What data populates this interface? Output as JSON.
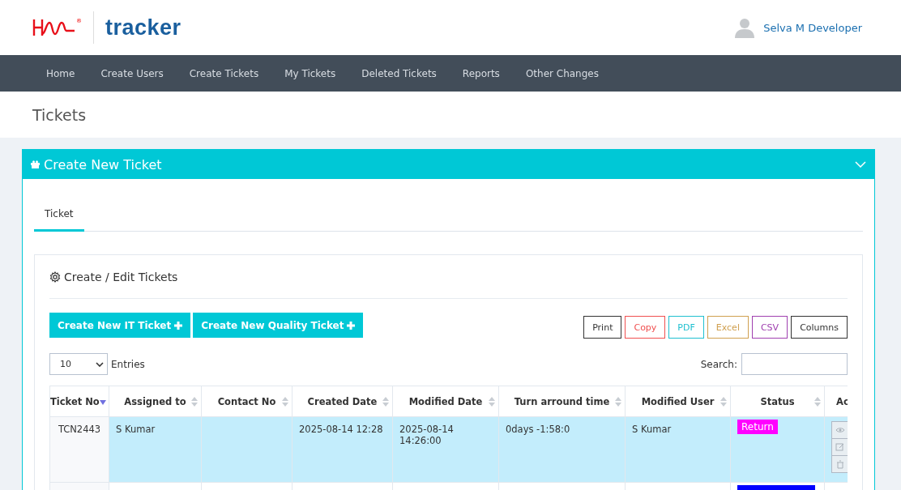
{
  "brand": {
    "logo_mark": "®",
    "name": "tracker"
  },
  "user": {
    "name": "Selva M Developer"
  },
  "nav": [
    {
      "label": "Home"
    },
    {
      "label": "Create Users"
    },
    {
      "label": "Create Tickets"
    },
    {
      "label": "My Tickets"
    },
    {
      "label": "Deleted Tickets"
    },
    {
      "label": "Reports"
    },
    {
      "label": "Other Changes"
    }
  ],
  "page_title": "Tickets",
  "panel": {
    "title": "Create New Ticket",
    "expanded": true
  },
  "tabs": [
    {
      "label": "Ticket",
      "selected": true
    }
  ],
  "section": {
    "title": "Create / Edit Tickets"
  },
  "create_buttons": [
    {
      "label": "Create New IT Ticket"
    },
    {
      "label": "Create New Quality Ticket"
    }
  ],
  "export_buttons": [
    {
      "label": "Print",
      "color": "#333333"
    },
    {
      "label": "Copy",
      "color": "#f05050"
    },
    {
      "label": "PDF",
      "color": "#20c0d0"
    },
    {
      "label": "Excel",
      "color": "#d0a050"
    },
    {
      "label": "CSV",
      "color": "#a040b0"
    },
    {
      "label": "Columns",
      "color": "#333333"
    }
  ],
  "entries": {
    "value": "10",
    "label": "Entries"
  },
  "search": {
    "label": "Search:"
  },
  "table": {
    "columns": [
      {
        "label": "Ticket No",
        "sorted": true
      },
      {
        "label": "Assigned to",
        "sorted": false
      },
      {
        "label": "Contact No",
        "sorted": false
      },
      {
        "label": "Created Date",
        "sorted": false
      },
      {
        "label": "Modified Date",
        "sorted": false
      },
      {
        "label": "Turn arround time",
        "sorted": false
      },
      {
        "label": "Modified User",
        "sorted": false
      },
      {
        "label": "Status",
        "sorted": false
      },
      {
        "label": "Ac"
      }
    ],
    "rows": [
      {
        "selected": true,
        "cells": [
          "TCN2443",
          "S Kumar",
          "",
          "2025-08-14 12:28",
          "2025-08-14 14:26:00",
          "0days -1:58:0",
          "S Kumar"
        ],
        "status": {
          "label": "Return",
          "color": "#ff00ff"
        }
      },
      {
        "selected": false,
        "cells": [
          "",
          "",
          "",
          "",
          "",
          "",
          ""
        ],
        "status": {
          "color": "#0000ff"
        }
      }
    ]
  }
}
